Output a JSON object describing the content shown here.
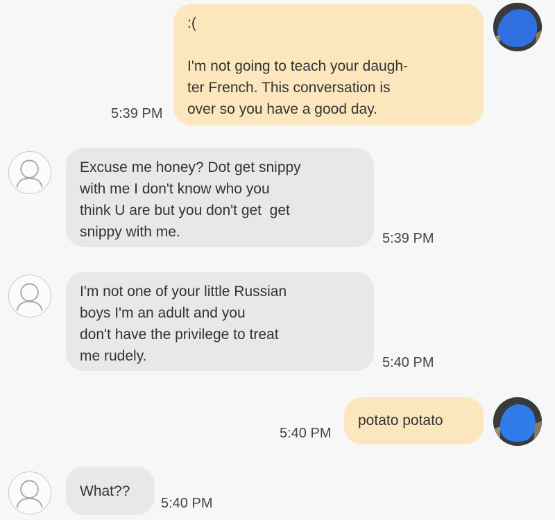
{
  "messages": [
    {
      "direction": "outgoing",
      "lines": [
        ":(",
        "",
        "I'm not going to teach your daugh-",
        "ter French. This conversation is",
        "over so you have a good day."
      ],
      "time": "5:39 PM"
    },
    {
      "direction": "incoming",
      "lines": [
        "Excuse me honey? Dot get snippy",
        "with me I don't know who you",
        "think U are but you don't get  get",
        "snippy with me."
      ],
      "time": "5:39 PM"
    },
    {
      "direction": "incoming",
      "lines": [
        "I'm not one of your little Russian",
        "boys I'm an adult and you",
        "don't have the privilege to treat",
        "me rudely."
      ],
      "time": "5:40 PM"
    },
    {
      "direction": "outgoing",
      "lines": [
        "potato potato"
      ],
      "time": "5:40 PM"
    },
    {
      "direction": "incoming",
      "lines": [
        "What??"
      ],
      "time": "5:40 PM"
    }
  ],
  "colors": {
    "outgoing_bubble": "#fbe6bd",
    "incoming_bubble": "#e8e8e8",
    "background": "#f7f7f7",
    "self_avatar_blur": "#2f6fe0"
  },
  "icons": {
    "contact_avatar": "person-silhouette-icon",
    "self_avatar": "user-photo-avatar"
  }
}
